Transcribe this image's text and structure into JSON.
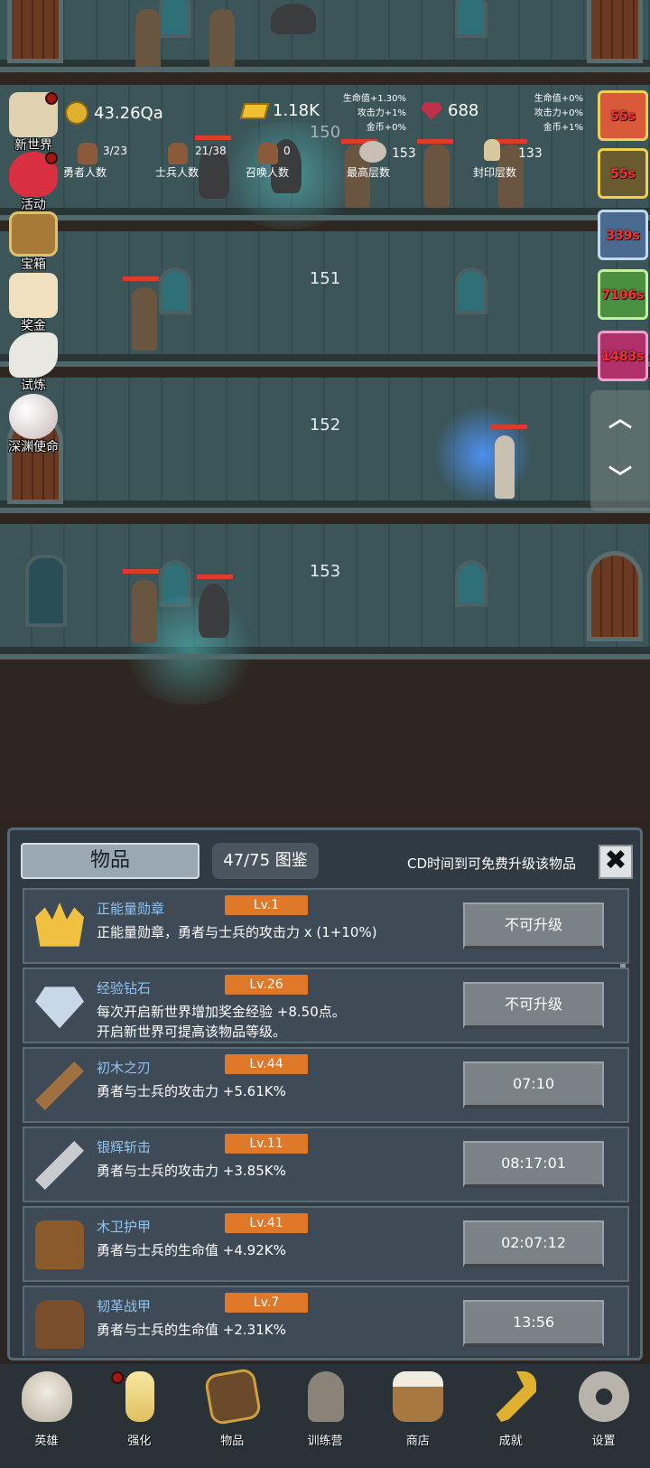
{
  "resources": {
    "coins": "43.26Qa",
    "gold": "1.18K",
    "gems": "688",
    "gold_bonus": [
      "生命值+1.30%",
      "攻击力+1%",
      "金币+0%"
    ],
    "gem_bonus": [
      "生命值+0%",
      "攻击力+0%",
      "金币+1%"
    ]
  },
  "counts": {
    "heroes": {
      "value": "3/23",
      "label": "勇者人数"
    },
    "soldiers": {
      "value": "21/38",
      "label": "士兵人数"
    },
    "summons": {
      "value": "0",
      "label": "召唤人数"
    },
    "highest_floor": {
      "value": "153",
      "label": "最高层数"
    },
    "sealed_floor": {
      "value": "133",
      "label": "封印层数"
    }
  },
  "floors": [
    "150",
    "151",
    "152",
    "153"
  ],
  "side_menu": [
    {
      "label": "新世界",
      "icon": "map-scroll-icon",
      "badge": true
    },
    {
      "label": "活动",
      "icon": "heart-icon",
      "badge": true
    },
    {
      "label": "宝箱",
      "icon": "treasure-chest-icon",
      "badge": false
    },
    {
      "label": "奖金",
      "icon": "envelope-icon",
      "badge": false
    },
    {
      "label": "试炼",
      "icon": "feather-icon",
      "badge": false
    },
    {
      "label": "深渊使命",
      "icon": "pearl-icon",
      "badge": false
    }
  ],
  "timers": [
    "55s",
    "55s",
    "339s",
    "7106s",
    "1483s"
  ],
  "panel": {
    "tab_label": "物品",
    "codex": "47/75 图鉴",
    "cd_note": "CD时间到可免费升级该物品",
    "close": "✖"
  },
  "items": [
    {
      "name": "正能量勋章",
      "level": "Lv.1",
      "desc": "正能量勋章，勇者与士兵的攻击力 x (1+10%)",
      "button": "不可升级",
      "icon": "crown-icon"
    },
    {
      "name": "经验钻石",
      "level": "Lv.26",
      "desc": "每次开启新世界增加奖金经验 +8.50点。\n开启新世界可提高该物品等级。",
      "button": "不可升级",
      "icon": "diamond-icon"
    },
    {
      "name": "初木之刃",
      "level": "Lv.44",
      "desc": "勇者与士兵的攻击力 +5.61K%",
      "button": "07:10",
      "icon": "wooden-sword-icon"
    },
    {
      "name": "银辉斩击",
      "level": "Lv.11",
      "desc": "勇者与士兵的攻击力 +3.85K%",
      "button": "08:17:01",
      "icon": "silver-sword-icon"
    },
    {
      "name": "木卫护甲",
      "level": "Lv.41",
      "desc": "勇者与士兵的生命值 +4.92K%",
      "button": "02:07:12",
      "icon": "wooden-armor-icon"
    },
    {
      "name": "韧革战甲",
      "level": "Lv.7",
      "desc": "勇者与士兵的生命值 +2.31K%",
      "button": "13:56",
      "icon": "leather-armor-icon"
    }
  ],
  "bottom_nav": [
    {
      "label": "英雄",
      "icon": "skull-icon",
      "badge": false
    },
    {
      "label": "强化",
      "icon": "candle-icon",
      "badge": true
    },
    {
      "label": "物品",
      "icon": "book-icon",
      "badge": false
    },
    {
      "label": "训练营",
      "icon": "lantern-icon",
      "badge": false
    },
    {
      "label": "商店",
      "icon": "beer-mug-icon",
      "badge": false
    },
    {
      "label": "成就",
      "icon": "key-icon",
      "badge": false
    },
    {
      "label": "设置",
      "icon": "gear-icon",
      "badge": false
    }
  ]
}
